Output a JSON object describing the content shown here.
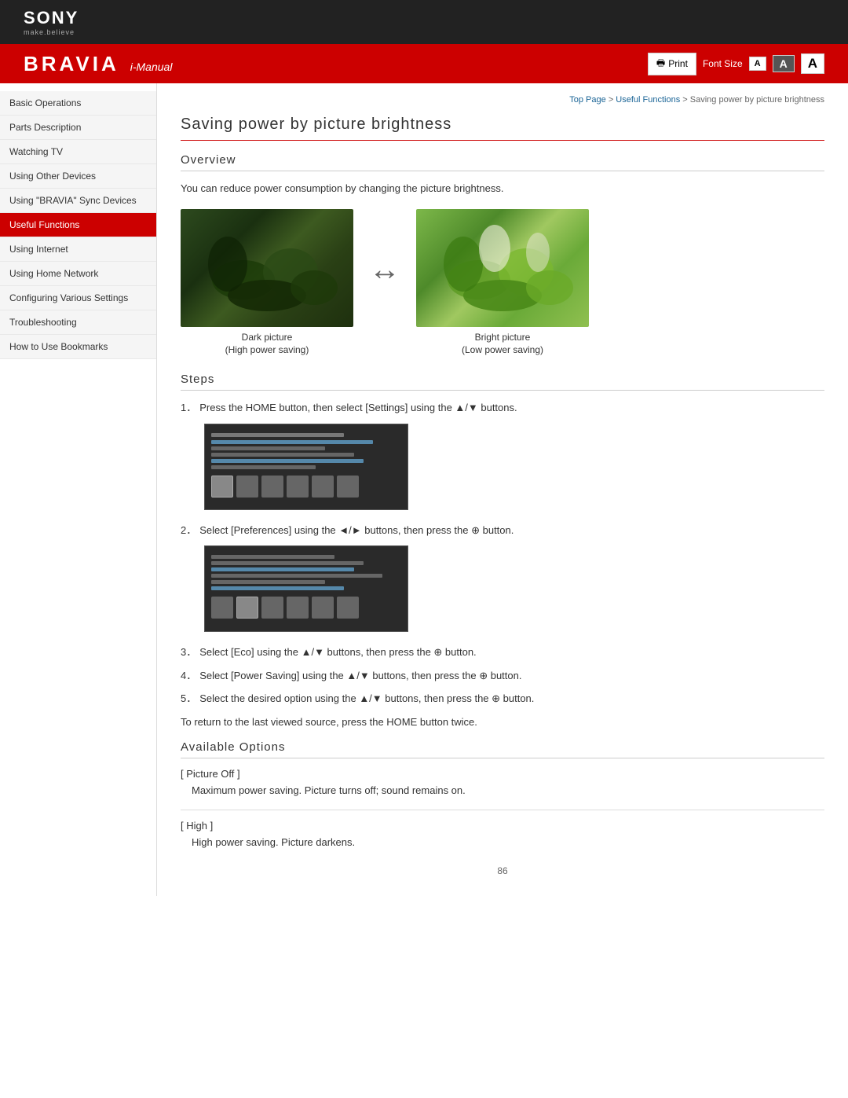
{
  "header": {
    "sony_logo": "SONY",
    "sony_tagline": "make.believe",
    "bravia_logo": "BRAVIA",
    "imanual": "i-Manual",
    "print_label": "Print",
    "font_size_label": "Font Size",
    "font_small": "A",
    "font_medium": "A",
    "font_large": "A"
  },
  "breadcrumb": {
    "top_page": "Top Page",
    "useful_functions": "Useful Functions",
    "current": "Saving power by picture brightness"
  },
  "sidebar": {
    "items": [
      {
        "id": "basic-operations",
        "label": "Basic Operations",
        "active": false
      },
      {
        "id": "parts-description",
        "label": "Parts Description",
        "active": false
      },
      {
        "id": "watching-tv",
        "label": "Watching TV",
        "active": false
      },
      {
        "id": "using-other-devices",
        "label": "Using Other Devices",
        "active": false
      },
      {
        "id": "using-bravia-sync",
        "label": "Using \"BRAVIA\" Sync Devices",
        "active": false
      },
      {
        "id": "useful-functions",
        "label": "Useful Functions",
        "active": true
      },
      {
        "id": "using-internet",
        "label": "Using Internet",
        "active": false
      },
      {
        "id": "using-home-network",
        "label": "Using Home Network",
        "active": false
      },
      {
        "id": "configuring-various",
        "label": "Configuring Various Settings",
        "active": false
      },
      {
        "id": "troubleshooting",
        "label": "Troubleshooting",
        "active": false
      },
      {
        "id": "how-to-use-bookmarks",
        "label": "How to Use Bookmarks",
        "active": false
      }
    ]
  },
  "content": {
    "page_title": "Saving power by picture brightness",
    "overview_heading": "Overview",
    "overview_text": "You can reduce power consumption by changing the picture brightness.",
    "dark_caption_line1": "Dark picture",
    "dark_caption_line2": "(High power saving)",
    "bright_caption_line1": "Bright picture",
    "bright_caption_line2": "(Low power saving)",
    "steps_heading": "Steps",
    "steps": [
      {
        "num": "1",
        "text": "Press the HOME button, then select [Settings] using the ▲/▼ buttons.",
        "has_screenshot": true
      },
      {
        "num": "2",
        "text": "Select  [Preferences] using the ◄/► buttons, then press the ⊕ button.",
        "has_screenshot": true
      },
      {
        "num": "3",
        "text": "Select [Eco] using the ▲/▼ buttons, then press the ⊕ button.",
        "has_screenshot": false
      },
      {
        "num": "4",
        "text": "Select [Power Saving] using the ▲/▼ buttons, then press the ⊕ button.",
        "has_screenshot": false
      },
      {
        "num": "5",
        "text": "Select the desired option using the ▲/▼ buttons, then press the ⊕ button.",
        "has_screenshot": false
      }
    ],
    "return_text": "To return to the last viewed source, press the HOME button twice.",
    "available_options_heading": "Available Options",
    "options": [
      {
        "label": "[ Picture Off ]",
        "desc": "Maximum power saving. Picture turns off; sound remains on."
      },
      {
        "label": "[ High ]",
        "desc": "High power saving. Picture darkens."
      }
    ],
    "page_number": "86"
  }
}
